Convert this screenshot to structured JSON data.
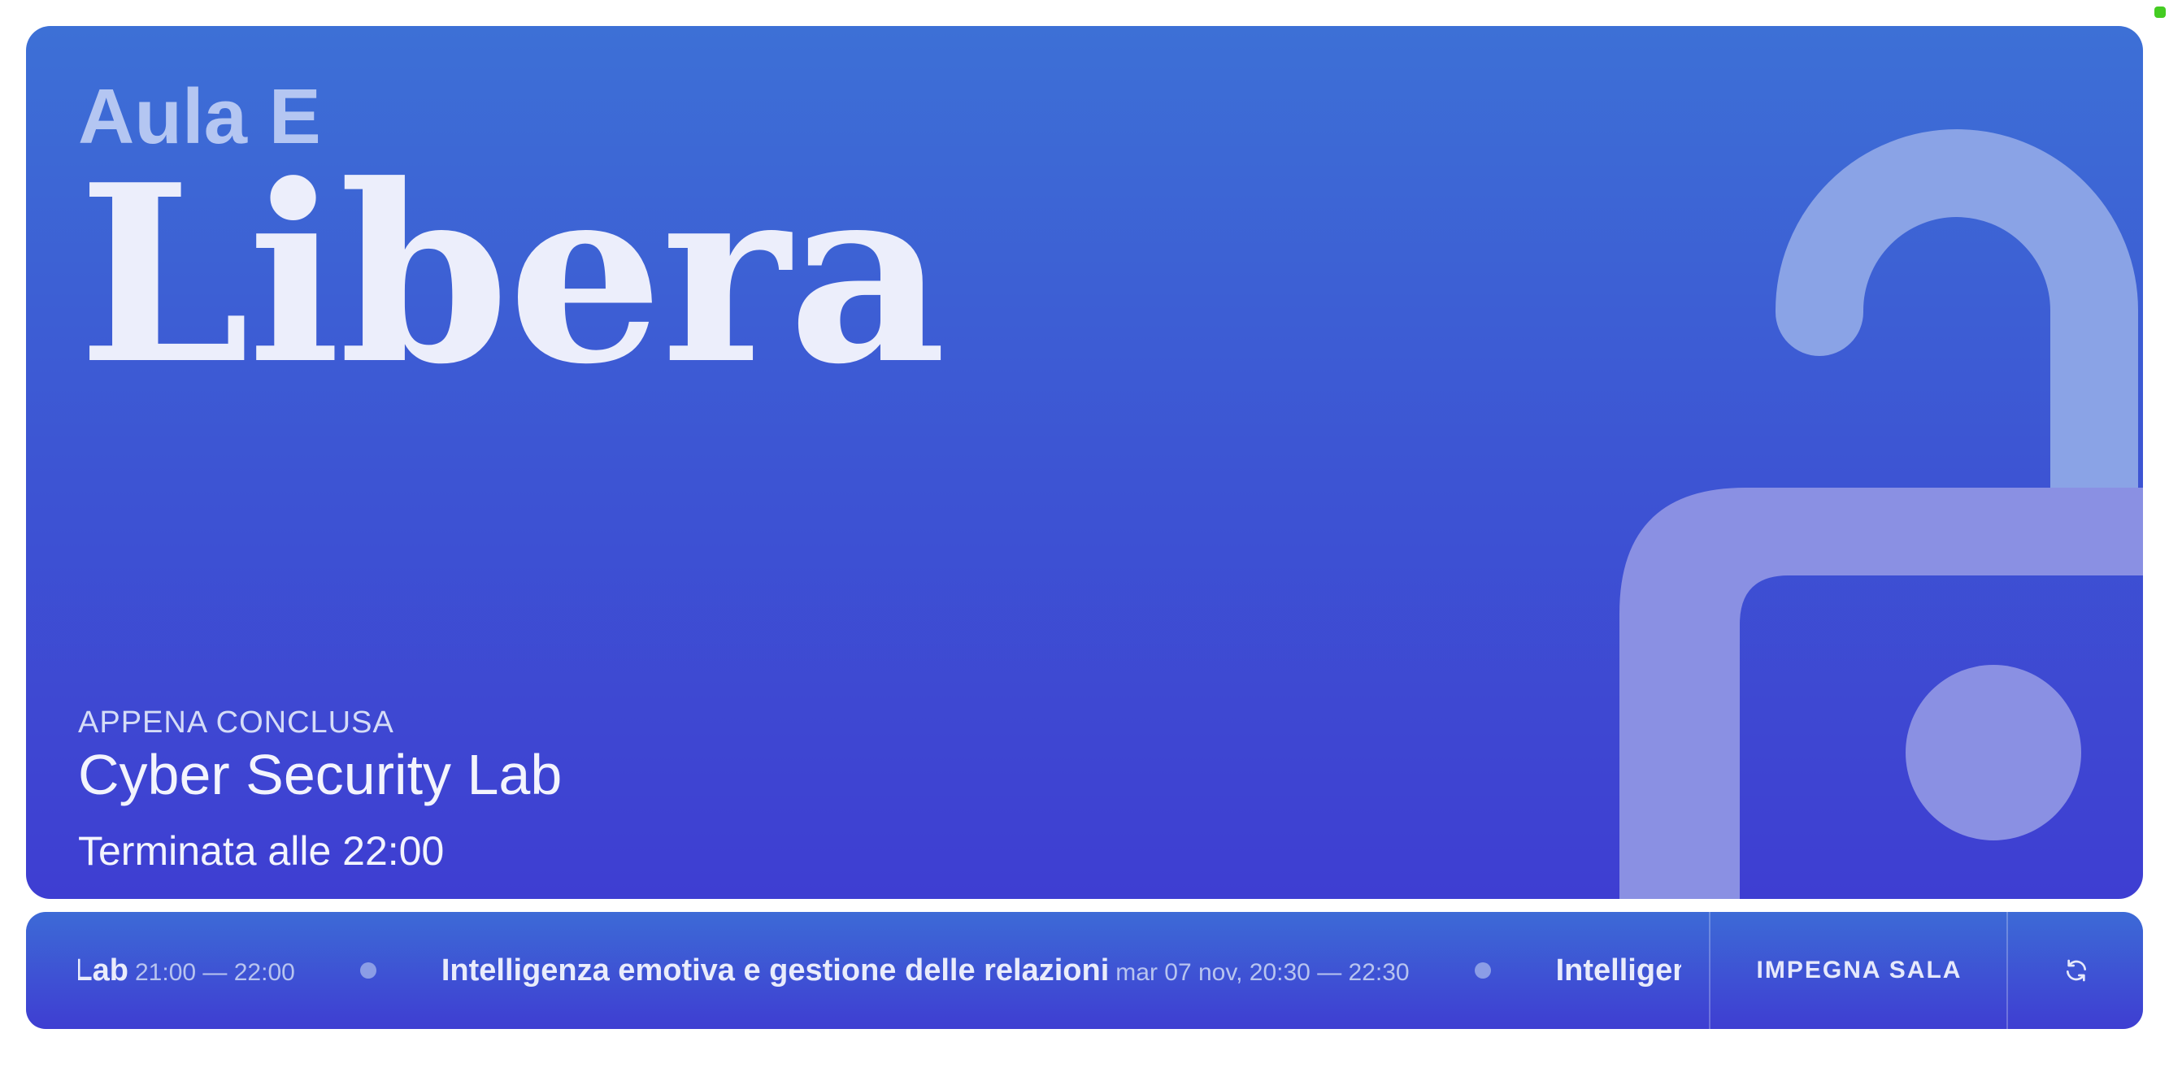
{
  "room": {
    "name": "Aula E",
    "state": "Libera"
  },
  "last_event": {
    "status_label": "APPENA CONCLUSA",
    "title": "Cyber Security Lab",
    "time_text": "Terminata alle 22:00"
  },
  "ticker": {
    "items": [
      {
        "name": "Cyber Security Lab",
        "when": "21:00 — 22:00"
      },
      {
        "name": "Intelligenza emotiva e gestione delle relazioni",
        "when": "mar 07 nov, 20:30 — 22:30"
      },
      {
        "name": "Intelligenza emotiva e gestione delle relazioni",
        "when": ""
      }
    ]
  },
  "actions": {
    "book_label": "IMPEGNA SALA",
    "refresh_icon": "refresh-icon"
  },
  "icons": {
    "state_icon": "unlocked-padlock-icon"
  },
  "colors": {
    "card_top": "#3d70d6",
    "card_bottom": "#3e3ed2",
    "lock": "#8aa3e6",
    "status_dot": "#44cc22"
  }
}
